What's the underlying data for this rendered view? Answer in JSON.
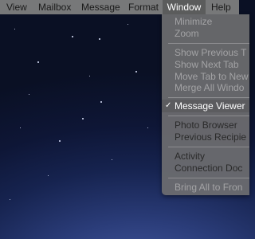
{
  "menubar": {
    "items": [
      {
        "label": "View"
      },
      {
        "label": "Mailbox"
      },
      {
        "label": "Message"
      },
      {
        "label": "Format"
      },
      {
        "label": "Window"
      },
      {
        "label": "Help"
      }
    ]
  },
  "window_menu": {
    "items": [
      {
        "label": "Minimize",
        "enabled": false
      },
      {
        "label": "Zoom",
        "enabled": false
      },
      {
        "label": "Show Previous T",
        "enabled": false
      },
      {
        "label": "Show Next Tab",
        "enabled": false
      },
      {
        "label": "Move Tab to New",
        "enabled": false
      },
      {
        "label": "Merge All Windo",
        "enabled": false
      },
      {
        "label": "Message Viewer",
        "enabled": true,
        "selected": true
      },
      {
        "label": "Photo Browser",
        "enabled": true
      },
      {
        "label": "Previous Recipie",
        "enabled": true
      },
      {
        "label": "Activity",
        "enabled": true
      },
      {
        "label": "Connection Doc",
        "enabled": true
      },
      {
        "label": "Bring All to Fron",
        "enabled": false
      }
    ]
  },
  "colors": {
    "menubar_bg": "#808080",
    "menu_bg": "#6e6e70",
    "selected_bg": "#5c5c5f",
    "disabled_text": "#a3a3a5"
  }
}
